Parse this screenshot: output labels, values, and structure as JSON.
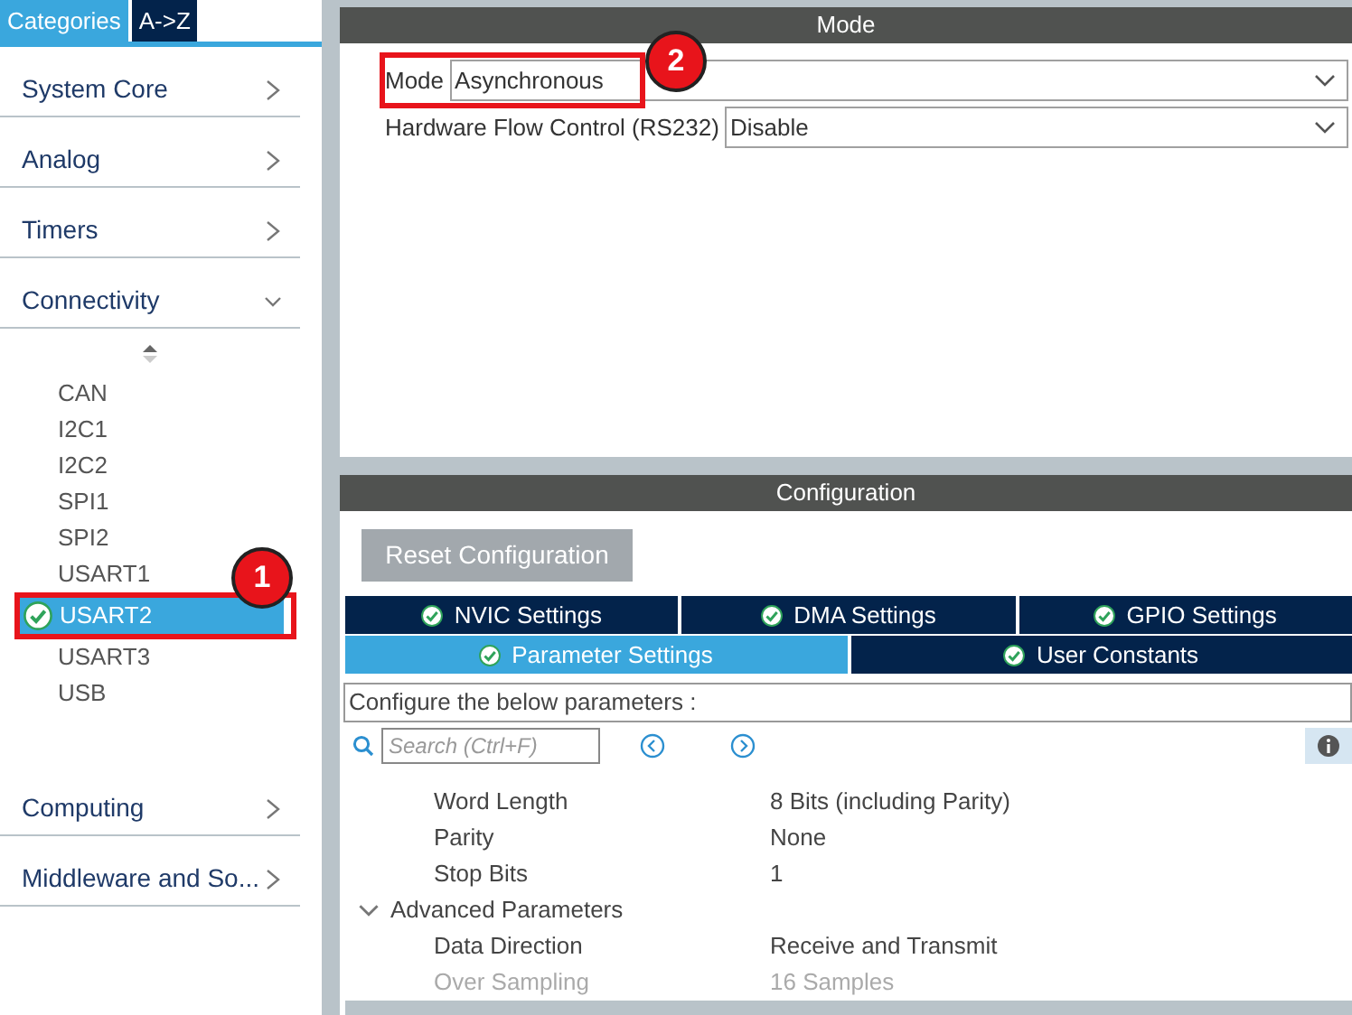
{
  "sidebar": {
    "tabs": [
      {
        "label": "Categories",
        "selected": true
      },
      {
        "label": "A->Z",
        "selected": false
      }
    ],
    "categories": [
      {
        "label": "System Core",
        "expanded": false
      },
      {
        "label": "Analog",
        "expanded": false
      },
      {
        "label": "Timers",
        "expanded": false
      },
      {
        "label": "Connectivity",
        "expanded": true,
        "items": [
          {
            "label": "CAN",
            "selected": false,
            "configured": false
          },
          {
            "label": "I2C1",
            "selected": false,
            "configured": false
          },
          {
            "label": "I2C2",
            "selected": false,
            "configured": false
          },
          {
            "label": "SPI1",
            "selected": false,
            "configured": false
          },
          {
            "label": "SPI2",
            "selected": false,
            "configured": false
          },
          {
            "label": "USART1",
            "selected": false,
            "configured": false
          },
          {
            "label": "USART2",
            "selected": true,
            "configured": true,
            "annotation": "1"
          },
          {
            "label": "USART3",
            "selected": false,
            "configured": false
          },
          {
            "label": "USB",
            "selected": false,
            "configured": false
          }
        ]
      },
      {
        "label": "Computing",
        "expanded": false
      },
      {
        "label": "Middleware and So...",
        "expanded": false
      }
    ]
  },
  "mode_panel": {
    "title": "Mode",
    "fields": [
      {
        "label": "Mode",
        "value": "Asynchronous",
        "annotation": "2"
      },
      {
        "label": "Hardware Flow Control (RS232)",
        "value": "Disable"
      }
    ]
  },
  "configuration": {
    "title": "Configuration",
    "reset_button": "Reset Configuration",
    "tab_rows": [
      [
        {
          "label": "NVIC Settings",
          "selected": false
        },
        {
          "label": "DMA Settings",
          "selected": false
        },
        {
          "label": "GPIO Settings",
          "selected": false
        }
      ],
      [
        {
          "label": "Parameter Settings",
          "selected": true
        },
        {
          "label": "User Constants",
          "selected": false
        }
      ]
    ],
    "hint": "Configure the below parameters :",
    "search": {
      "placeholder": "Search (Ctrl+F)"
    },
    "parameters": [
      {
        "kind": "param",
        "name": "Word Length",
        "value": "8 Bits (including Parity)",
        "disabled": false
      },
      {
        "kind": "param",
        "name": "Parity",
        "value": "None",
        "disabled": false
      },
      {
        "kind": "param",
        "name": "Stop Bits",
        "value": "1",
        "disabled": false
      },
      {
        "kind": "group",
        "name": "Advanced Parameters",
        "expanded": true
      },
      {
        "kind": "param",
        "name": "Data Direction",
        "value": "Receive and Transmit",
        "disabled": false
      },
      {
        "kind": "param",
        "name": "Over Sampling",
        "value": "16 Samples",
        "disabled": true
      }
    ]
  }
}
